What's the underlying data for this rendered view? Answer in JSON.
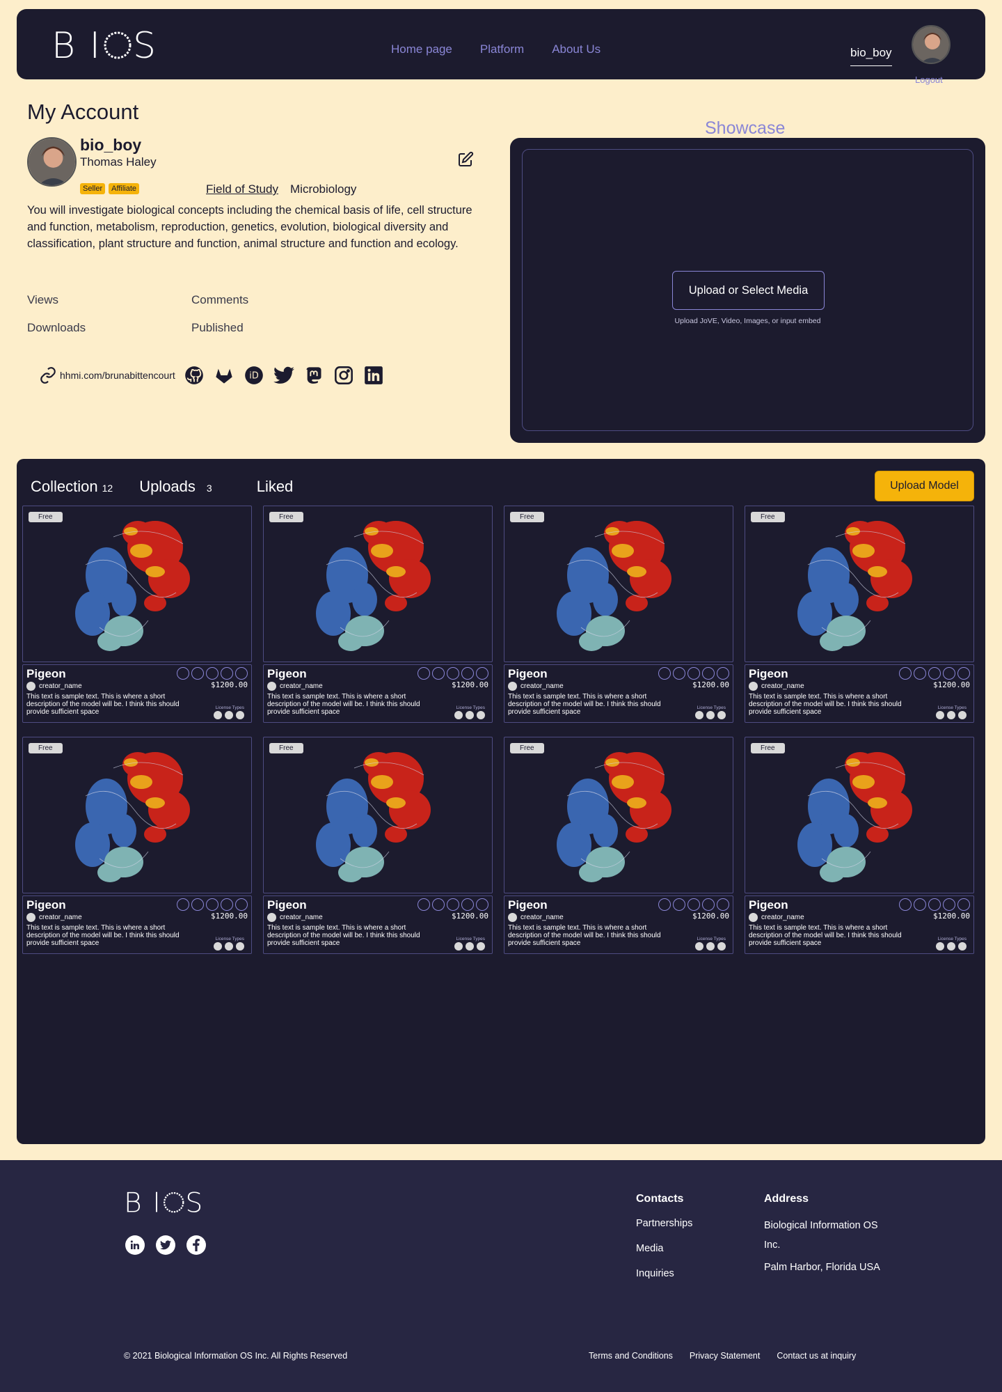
{
  "header": {
    "logo": "BIOS",
    "nav": [
      "Home page",
      "Platform",
      "About Us"
    ],
    "username": "bio_boy",
    "logout": "Logout"
  },
  "account": {
    "heading": "My Account",
    "username": "bio_boy",
    "fullname": "Thomas Haley",
    "badges": [
      "Seller",
      "Affiliate"
    ],
    "field_label": "Field of Study",
    "field_value": "Microbiology",
    "bio": "You will investigate biological concepts including the chemical basis of life, cell structure and function, metabolism, reproduction, genetics, evolution, biological diversity and classification, plant structure and function, animal structure and function and ecology.",
    "stats": {
      "views": "Views",
      "comments": "Comments",
      "downloads": "Downloads",
      "published": "Published"
    },
    "website": "hhmi.com/brunabittencourt",
    "socials": [
      "github-icon",
      "gitlab-icon",
      "orcid-icon",
      "twitter-icon",
      "mastodon-icon",
      "instagram-icon",
      "linkedin-icon"
    ]
  },
  "showcase": {
    "title": "Showcase",
    "upload_button": "Upload or Select Media",
    "hint": "Upload JoVE, Video, Images, or input embed"
  },
  "models": {
    "tabs": [
      {
        "label": "Collection",
        "count": "12"
      },
      {
        "label": "Uploads",
        "count": "3"
      },
      {
        "label": "Liked",
        "count": ""
      }
    ],
    "upload_button": "Upload Model",
    "cards": [
      {
        "tag": "Free",
        "title": "Pigeon",
        "creator": "creator_name",
        "price": "$1200.00",
        "desc": "This text is sample text. This is where a short description of the model will be. I think this should provide sufficient space",
        "license_label": "License Types"
      },
      {
        "tag": "Free",
        "title": "Pigeon",
        "creator": "creator_name",
        "price": "$1200.00",
        "desc": "This text is sample text. This is where a short description of the model will be. I think this should provide sufficient space",
        "license_label": "License Types"
      },
      {
        "tag": "Free",
        "title": "Pigeon",
        "creator": "creator_name",
        "price": "$1200.00",
        "desc": "This text is sample text. This is where a short description of the model will be. I think this should provide sufficient space",
        "license_label": "License Types"
      },
      {
        "tag": "Free",
        "title": "Pigeon",
        "creator": "creator_name",
        "price": "$1200.00",
        "desc": "This text is sample text. This is where a short description of the model will be. I think this should provide sufficient space",
        "license_label": "License Types"
      },
      {
        "tag": "Free",
        "title": "Pigeon",
        "creator": "creator_name",
        "price": "$1200.00",
        "desc": "This text is sample text. This is where a short description of the model will be. I think this should provide sufficient space",
        "license_label": "License Types"
      },
      {
        "tag": "Free",
        "title": "Pigeon",
        "creator": "creator_name",
        "price": "$1200.00",
        "desc": "This text is sample text. This is where a short description of the model will be. I think this should provide sufficient space",
        "license_label": "License Types"
      },
      {
        "tag": "Free",
        "title": "Pigeon",
        "creator": "creator_name",
        "price": "$1200.00",
        "desc": "This text is sample text. This is where a short description of the model will be. I think this should provide sufficient space",
        "license_label": "License Types"
      },
      {
        "tag": "Free",
        "title": "Pigeon",
        "creator": "creator_name",
        "price": "$1200.00",
        "desc": "This text is sample text. This is where a short description of the model will be. I think this should provide sufficient space",
        "license_label": "License Types"
      }
    ]
  },
  "footer": {
    "logo": "BIOS",
    "socials": [
      "linkedin-icon",
      "twitter-icon",
      "facebook-icon"
    ],
    "contacts_title": "Contacts",
    "contacts": [
      "Partnerships",
      "Media",
      "Inquiries"
    ],
    "address_title": "Address",
    "address": "Biological Information OS Inc.",
    "address2": "Palm Harbor, Florida USA",
    "copyright": "© 2021 Biological Information OS Inc. All Rights Reserved",
    "bottom_links": [
      "Terms and Conditions",
      "Privacy Statement",
      "Contact us at inquiry"
    ]
  },
  "colors": {
    "dark": "#1c1b2e",
    "cream": "#fdeecb",
    "accent": "#8a86d6",
    "yellow": "#f5b30a",
    "footer": "#272642"
  }
}
